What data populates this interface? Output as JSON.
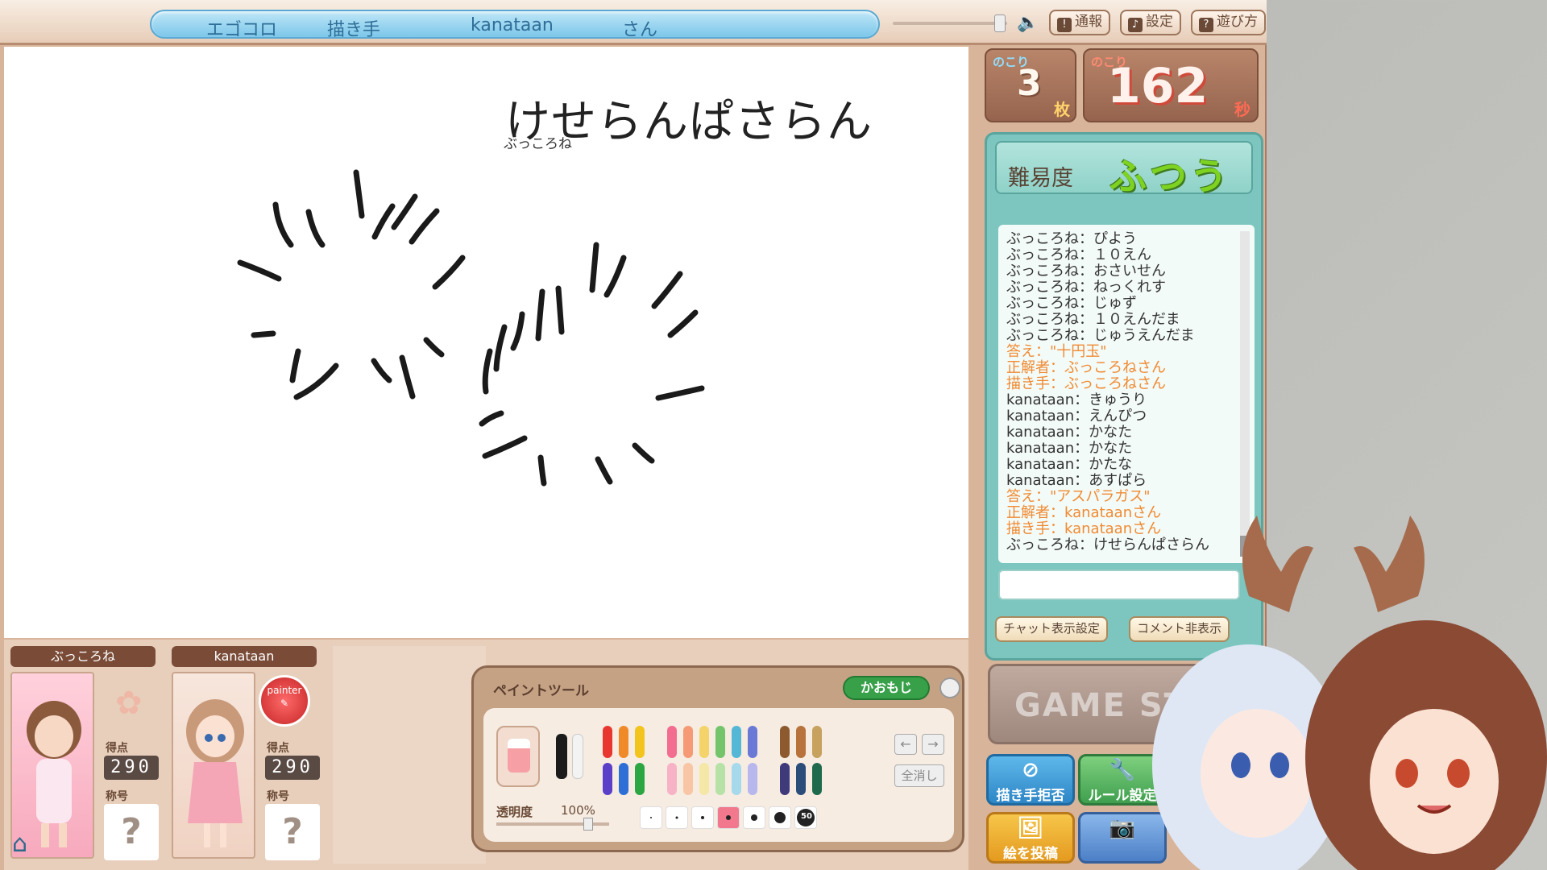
{
  "header": {
    "segments": [
      "エゴコロ",
      "描き手",
      "kanataan",
      "さん"
    ],
    "buttons": [
      {
        "label": "通報",
        "icon": "report-icon"
      },
      {
        "label": "設定",
        "icon": "settings-icon"
      },
      {
        "label": "遊び方",
        "icon": "help-icon"
      }
    ]
  },
  "canvas": {
    "word": "けせらんぱさらん",
    "author": "ぶっころね"
  },
  "counters": {
    "sheets_label": "のこり",
    "sheets_value": "3",
    "sheets_unit": "枚",
    "seconds_label": "のこり",
    "seconds_value": "162",
    "seconds_unit": "秒"
  },
  "difficulty": {
    "label": "難易度",
    "value": "ふつう"
  },
  "chat": {
    "lines": [
      {
        "text": "ぶっころね：ぴよう",
        "type": "msg"
      },
      {
        "text": "ぶっころね：１０えん",
        "type": "msg"
      },
      {
        "text": "ぶっころね：おさいせん",
        "type": "msg"
      },
      {
        "text": "ぶっころね：ねっくれす",
        "type": "msg"
      },
      {
        "text": "ぶっころね：じゅず",
        "type": "msg"
      },
      {
        "text": "ぶっころね：１０えんだま",
        "type": "msg"
      },
      {
        "text": "ぶっころね：じゅうえんだま",
        "type": "msg"
      },
      {
        "text": "答え：\"十円玉\"",
        "type": "sys"
      },
      {
        "text": "正解者：ぶっころねさん",
        "type": "sys"
      },
      {
        "text": "描き手：ぶっころねさん",
        "type": "sys"
      },
      {
        "text": "kanataan：きゅうり",
        "type": "msg"
      },
      {
        "text": "kanataan：えんぴつ",
        "type": "msg"
      },
      {
        "text": "kanataan：かなた",
        "type": "msg"
      },
      {
        "text": "kanataan：かなた",
        "type": "msg"
      },
      {
        "text": "kanataan：かたな",
        "type": "msg"
      },
      {
        "text": "kanataan：あすぱら",
        "type": "msg"
      },
      {
        "text": "答え：\"アスパラガス\"",
        "type": "sys"
      },
      {
        "text": "正解者：kanataanさん",
        "type": "sys"
      },
      {
        "text": "描き手：kanataanさん",
        "type": "sys"
      },
      {
        "text": "ぶっころね：けせらんぱさらん",
        "type": "msg"
      }
    ],
    "input_value": "",
    "settings_button": "チャット表示設定",
    "hide_comments_button": "コメント非表示"
  },
  "game_start": "GAME STA",
  "action_buttons": {
    "refuse_drawer": "描き手拒否",
    "rule_settings": "ルール設定",
    "post_picture": "絵を投稿"
  },
  "players": [
    {
      "name": "ぶっころね",
      "score_label": "得点",
      "score": "290",
      "title_label": "称号",
      "title": "?"
    },
    {
      "name": "kanataan",
      "score_label": "得点",
      "score": "290",
      "title_label": "称号",
      "title": "?",
      "badge": "painter"
    }
  ],
  "paint_tool": {
    "title": "ペイントツール",
    "face_button": "かおもじ",
    "opacity_label": "透明度",
    "opacity_value": "100%",
    "clear_all": "全消し",
    "size_max": "50"
  },
  "colors": {
    "pens_row1": [
      "#e8372f",
      "#f08a28",
      "#f2c41d",
      "#f26d8f",
      "#f59a74",
      "#f3d36a",
      "#73c46b",
      "#54b7d6",
      "#6a78d6",
      "#8c5a2e",
      "#b8733c",
      "#c6a25e"
    ],
    "pens_row2": [
      "#5a3fc8",
      "#2d6fd6",
      "#2ca642",
      "#f7b3c5",
      "#f8c6a5",
      "#f5e7a6",
      "#b6e2a8",
      "#a6d9ec",
      "#b7b7ee",
      "#3f3a7a",
      "#2b4d7a",
      "#1f6a4d"
    ]
  }
}
